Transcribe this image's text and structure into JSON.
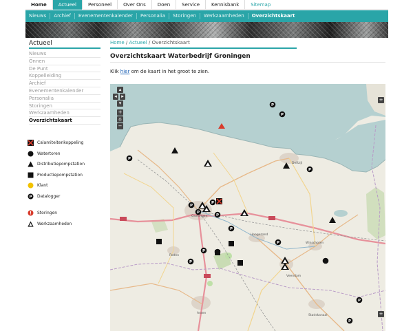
{
  "topnav": {
    "tabs": [
      {
        "label": "Home"
      },
      {
        "label": "Actueel"
      },
      {
        "label": "Personeel"
      },
      {
        "label": "Over Ons"
      },
      {
        "label": "Doen"
      },
      {
        "label": "Service"
      },
      {
        "label": "Kennisbank"
      },
      {
        "label": "Sitemap"
      }
    ]
  },
  "subnav": {
    "items": [
      {
        "label": "Nieuws"
      },
      {
        "label": "Archief"
      },
      {
        "label": "Evenementenkalender"
      },
      {
        "label": "Personalia"
      },
      {
        "label": "Storingen"
      },
      {
        "label": "Werkzaamheden"
      },
      {
        "label": "Overzichtskaart"
      }
    ]
  },
  "sidebar": {
    "title": "Actueel",
    "items": [
      {
        "label": "Nieuws"
      },
      {
        "label": "Onnen"
      },
      {
        "label": "De Punt"
      },
      {
        "label": "Koppelleiding"
      },
      {
        "label": "Archief"
      },
      {
        "label": "Evenementenkalender"
      },
      {
        "label": "Personalia"
      },
      {
        "label": "Storingen"
      },
      {
        "label": "Werkzaamheden"
      },
      {
        "label": "Overzichtskaart"
      }
    ]
  },
  "legend": {
    "items": [
      {
        "label": "Calamiteitenkoppeling",
        "icon": "calamity-coupling-icon"
      },
      {
        "label": "Watertoren",
        "icon": "water-tower-icon"
      },
      {
        "label": "Distributiepompstation",
        "icon": "distribution-station-icon"
      },
      {
        "label": "Productiepompstation",
        "icon": "production-station-icon"
      },
      {
        "label": "Klant",
        "icon": "customer-icon"
      },
      {
        "label": "Datalogger",
        "icon": "datalogger-icon"
      }
    ],
    "alerts": [
      {
        "label": "Storingen",
        "icon": "outage-icon"
      },
      {
        "label": "Werkzaamheden",
        "icon": "works-icon"
      }
    ]
  },
  "breadcrumb": {
    "home": "Home",
    "sep1": " / ",
    "section": "Actueel",
    "sep2": " / ",
    "current": "Overzichtskaart"
  },
  "page": {
    "title": "Overzichtskaart Waterbedrijf Groningen",
    "intro_before": "Klik ",
    "intro_link": "hier",
    "intro_after": " om de kaart in het groot te zien."
  },
  "map": {
    "controls": {
      "zoom_in": "+",
      "zoom_out": "−",
      "layers": "+"
    },
    "place_labels": [
      "Groningen",
      "Hoogezand",
      "Delfzijl",
      "Winschoten",
      "Assen",
      "Veendam",
      "Stadskanaal",
      "Roden"
    ]
  },
  "colors": {
    "accent": "#2aa5a8",
    "water": "#b5d0d0",
    "land": "#f0eee6",
    "outage": "#d83b2b",
    "customer": "#f2c200"
  }
}
